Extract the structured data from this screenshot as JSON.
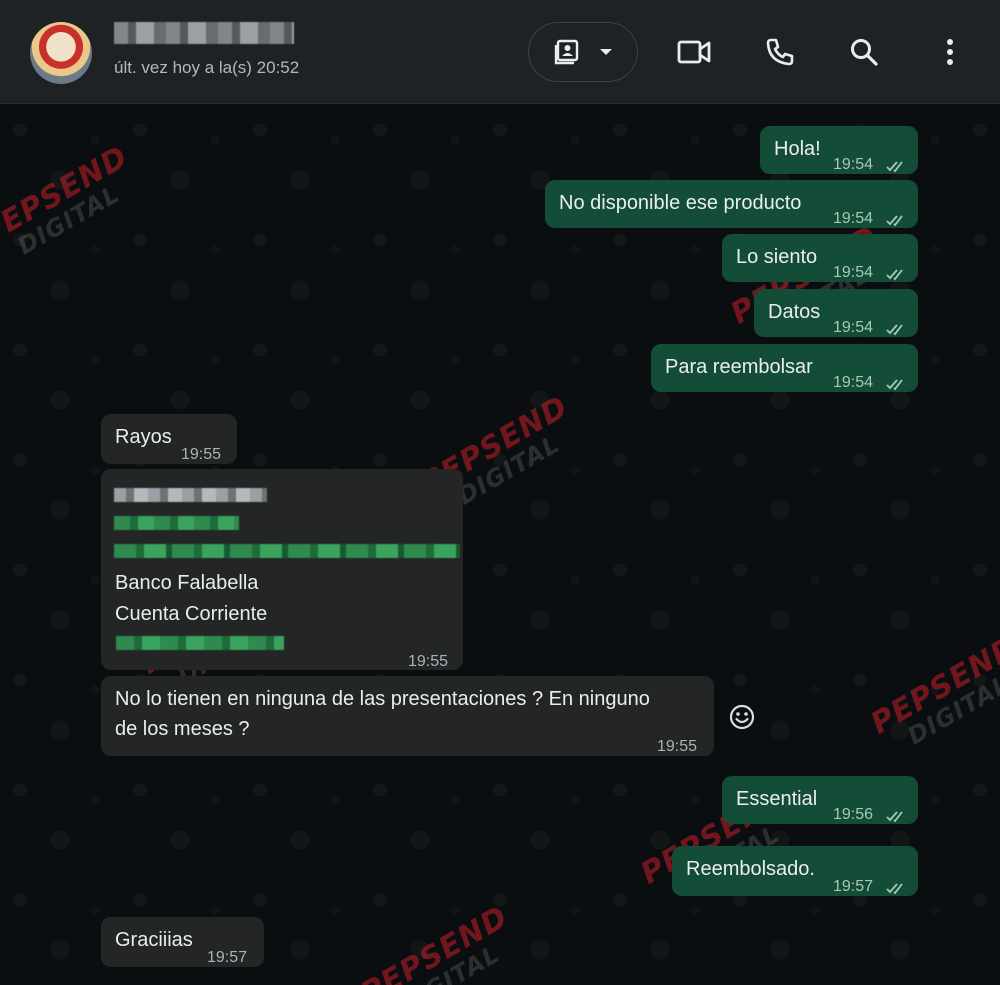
{
  "header": {
    "last_seen": "últ. vez hoy a la(s) 20:52"
  },
  "icons": {
    "contact_card": "contact-card-icon",
    "dropdown": "chevron-down-icon",
    "video": "video-call-icon",
    "phone": "phone-icon",
    "search": "search-icon",
    "menu": "menu-icon"
  },
  "watermark": {
    "line1": "PEPSEND",
    "line2": "DIGITAL"
  },
  "messages": [
    {
      "dir": "out",
      "text": "Hola!",
      "time": "19:54"
    },
    {
      "dir": "out",
      "text": "No disponible ese producto",
      "time": "19:54"
    },
    {
      "dir": "out",
      "text": "Lo siento",
      "time": "19:54"
    },
    {
      "dir": "out",
      "text": "Datos",
      "time": "19:54"
    },
    {
      "dir": "out",
      "text": "Para reembolsar",
      "time": "19:54"
    },
    {
      "dir": "in",
      "text": "Rayos",
      "time": "19:55"
    },
    {
      "dir": "in",
      "bank": "Banco Falabella",
      "account": "Cuenta Corriente",
      "time": "19:55"
    },
    {
      "dir": "in",
      "text_line1": "No lo tienen en ninguna de las presentaciones ? En ninguno",
      "text_line2": "de los meses ?",
      "time": "19:55"
    },
    {
      "dir": "out",
      "text": "Essential",
      "time": "19:56"
    },
    {
      "dir": "out",
      "text": "Reembolsado.",
      "time": "19:57"
    },
    {
      "dir": "in",
      "text": "Graciiias",
      "time": "19:57"
    }
  ],
  "colors": {
    "outgoing_bubble": "#144d37",
    "incoming_bubble": "#242626",
    "header_bg": "#1e2225",
    "read_ticks": "#a9c7b8"
  }
}
